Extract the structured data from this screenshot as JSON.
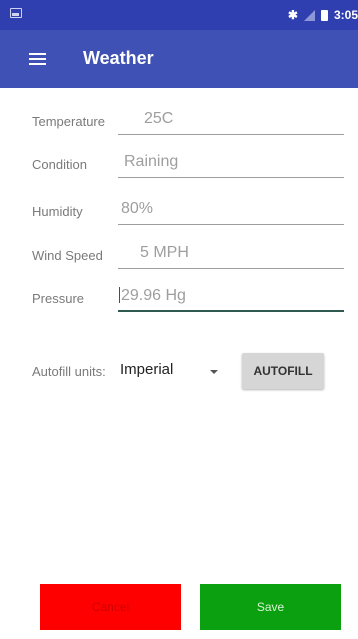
{
  "status_bar": {
    "time": "3:05",
    "bluetooth_icon": "bluetooth-icon",
    "signal_icon": "signal-icon",
    "battery_icon": "battery-icon"
  },
  "toolbar": {
    "title": "Weather",
    "menu_icon": "hamburger-menu-icon"
  },
  "fields": [
    {
      "label": "Temperature",
      "value": "25C"
    },
    {
      "label": "Condition",
      "value": "Raining"
    },
    {
      "label": "Humidity",
      "value": "80%"
    },
    {
      "label": "Wind Speed",
      "value": "5 MPH"
    },
    {
      "label": "Pressure",
      "value": "29.96 Hg"
    }
  ],
  "autofill": {
    "label": "Autofill units:",
    "selected_unit": "Imperial",
    "button_label": "AUTOFILL"
  },
  "actions": {
    "cancel_label": "Cancel",
    "save_label": "Save"
  },
  "colors": {
    "status_bar": "#2f3fb0",
    "toolbar": "#3f51b5",
    "cancel": "#ff0000",
    "save": "#0aa010"
  }
}
